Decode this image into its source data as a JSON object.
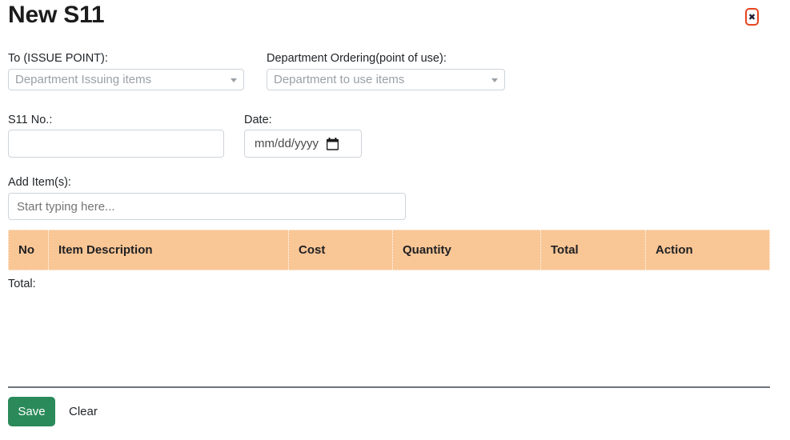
{
  "header": {
    "title": "New S11",
    "close_icon": "close-x-icon",
    "close_label": "✖",
    "close_border_color": "#e8431f"
  },
  "form": {
    "issue_point": {
      "label": "To (ISSUE POINT):",
      "placeholder": "Department Issuing items",
      "value": "",
      "arrow_icon": "chevron-down-icon"
    },
    "department_ordering": {
      "label": "Department Ordering(point of use):",
      "placeholder": "Department to use items",
      "value": "",
      "arrow_icon": "chevron-down-icon"
    },
    "s11_no": {
      "label": "S11 No.:",
      "placeholder": "",
      "value": ""
    },
    "date": {
      "label": "Date:",
      "placeholder": "mm/dd/yyyy",
      "value": "",
      "icon": "calendar-icon"
    },
    "add_items": {
      "label": "Add Item(s):",
      "placeholder": "Start typing here...",
      "value": ""
    }
  },
  "table": {
    "header_background": "#f9c695",
    "columns": [
      {
        "key": "no",
        "label": "No"
      },
      {
        "key": "description",
        "label": "Item Description"
      },
      {
        "key": "cost",
        "label": "Cost"
      },
      {
        "key": "quantity",
        "label": "Quantity"
      },
      {
        "key": "total",
        "label": "Total"
      },
      {
        "key": "action",
        "label": "Action"
      }
    ],
    "rows": [],
    "total_label": "Total:",
    "total_value": ""
  },
  "footer": {
    "save_label": "Save",
    "save_color": "#2b8a5a",
    "clear_label": "Clear"
  }
}
